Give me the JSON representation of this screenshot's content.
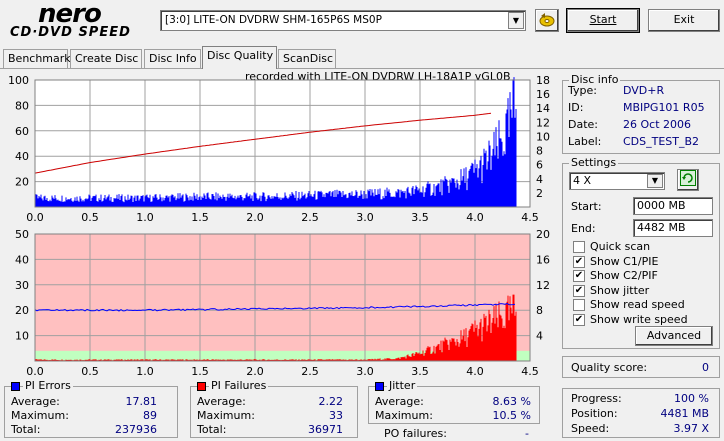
{
  "header": {
    "logo_top": "nero",
    "logo_bottom": "CD·DVD SPEED",
    "drive": "[3:0]  LITE-ON DVDRW SHM-165P6S MS0P",
    "start_label": "Start",
    "exit_label": "Exit"
  },
  "tabs": [
    {
      "label": "Benchmark"
    },
    {
      "label": "Create Disc"
    },
    {
      "label": "Disc Info"
    },
    {
      "label": "Disc Quality"
    },
    {
      "label": "ScanDisc"
    }
  ],
  "recorded_with": "recorded with LITE-ON DVDRW LH-18A1P   vGL0B",
  "chart_data": [
    {
      "type": "area",
      "title": "recorded with LITE-ON DVDRW LH-18A1P   vGL0B",
      "x_ticks": [
        "0.0",
        "0.5",
        "1.0",
        "1.5",
        "2.0",
        "2.5",
        "3.0",
        "3.5",
        "4.0",
        "4.5"
      ],
      "y_left_ticks": [
        "20",
        "40",
        "60",
        "80",
        "100"
      ],
      "y_right_ticks": [
        "2",
        "4",
        "6",
        "8",
        "10",
        "12",
        "14",
        "16",
        "18"
      ],
      "xlim": [
        0,
        4.5
      ],
      "ylim_left": [
        0,
        100
      ],
      "ylim_right": [
        0,
        18
      ],
      "series": [
        {
          "name": "PI Errors",
          "color": "#0000ff",
          "axis": "left",
          "x": [
            0.0,
            0.5,
            1.0,
            1.5,
            2.0,
            2.5,
            3.0,
            3.3,
            3.5,
            3.7,
            3.9,
            4.0,
            4.1,
            4.2,
            4.3,
            4.35,
            4.38
          ],
          "y": [
            7,
            7,
            7,
            8,
            8,
            9,
            10,
            11,
            13,
            16,
            22,
            28,
            35,
            45,
            60,
            75,
            80
          ]
        },
        {
          "name": "Speed",
          "color": "#cc0000",
          "axis": "right",
          "x": [
            0.0,
            0.5,
            1.0,
            1.5,
            2.0,
            2.5,
            3.0,
            3.5,
            4.0,
            4.15
          ],
          "y": [
            4.8,
            6.3,
            7.5,
            8.6,
            9.6,
            10.6,
            11.5,
            12.3,
            13.0,
            13.3
          ]
        }
      ]
    },
    {
      "type": "area",
      "x_ticks": [
        "0.0",
        "0.5",
        "1.0",
        "1.5",
        "2.0",
        "2.5",
        "3.0",
        "3.5",
        "4.0",
        "4.5"
      ],
      "y_left_ticks": [
        "10",
        "20",
        "30",
        "40",
        "50"
      ],
      "y_right_ticks": [
        "4",
        "8",
        "12",
        "16",
        "20"
      ],
      "xlim": [
        0,
        4.5
      ],
      "ylim_left": [
        0,
        50
      ],
      "ylim_right": [
        0,
        20
      ],
      "series": [
        {
          "name": "PI Failures",
          "color": "#ff0000",
          "axis": "left",
          "x": [
            0.0,
            1.0,
            2.0,
            3.0,
            3.3,
            3.5,
            3.7,
            3.9,
            4.0,
            4.1,
            4.2,
            4.3,
            4.38
          ],
          "y": [
            0.5,
            0.5,
            0.5,
            0.5,
            1,
            3,
            6,
            9,
            12,
            14,
            16,
            18,
            20
          ]
        },
        {
          "name": "Jitter",
          "color": "#0000ff",
          "axis": "right",
          "x": [
            0.0,
            0.5,
            1.0,
            1.5,
            2.0,
            2.5,
            3.0,
            3.5,
            4.0,
            4.38
          ],
          "y": [
            8.0,
            8.0,
            8.0,
            8.1,
            8.2,
            8.3,
            8.4,
            8.6,
            8.8,
            9.0
          ]
        }
      ]
    }
  ],
  "disc_info": {
    "title": "Disc info",
    "rows": [
      {
        "label": "Type:",
        "value": "DVD+R"
      },
      {
        "label": "ID:",
        "value": "MBIPG101 R05"
      },
      {
        "label": "Date:",
        "value": "26 Oct 2006"
      },
      {
        "label": "Label:",
        "value": "CDS_TEST_B2"
      }
    ]
  },
  "settings": {
    "title": "Settings",
    "speed": "4 X",
    "start_label": "Start:",
    "start_value": "0000 MB",
    "end_label": "End:",
    "end_value": "4482 MB",
    "checks": [
      {
        "label": "Quick scan",
        "checked": false
      },
      {
        "label": "Show C1/PIE",
        "checked": true
      },
      {
        "label": "Show C2/PIF",
        "checked": true
      },
      {
        "label": "Show jitter",
        "checked": true
      },
      {
        "label": "Show read speed",
        "checked": false
      },
      {
        "label": "Show write speed",
        "checked": true
      }
    ],
    "advanced_label": "Advanced"
  },
  "quality": {
    "label": "Quality score:",
    "value": "0"
  },
  "progress": {
    "rows": [
      {
        "label": "Progress:",
        "value": "100 %"
      },
      {
        "label": "Position:",
        "value": "4481 MB"
      },
      {
        "label": "Speed:",
        "value": "3.97 X"
      }
    ]
  },
  "stats": {
    "pi_errors": {
      "title": "PI Errors",
      "color": "#0000ff",
      "rows": [
        {
          "label": "Average:",
          "value": "17.81"
        },
        {
          "label": "Maximum:",
          "value": "89"
        },
        {
          "label": "Total:",
          "value": "237936"
        }
      ]
    },
    "pi_failures": {
      "title": "PI Failures",
      "color": "#ff0000",
      "rows": [
        {
          "label": "Average:",
          "value": "2.22"
        },
        {
          "label": "Maximum:",
          "value": "33"
        },
        {
          "label": "Total:",
          "value": "36971"
        }
      ]
    },
    "jitter": {
      "title": "Jitter",
      "color": "#0000ff",
      "rows": [
        {
          "label": "Average:",
          "value": "8.63 %"
        },
        {
          "label": "Maximum:",
          "value": "10.5 %"
        }
      ]
    },
    "po_failures": {
      "label": "PO failures:",
      "value": "-"
    }
  }
}
